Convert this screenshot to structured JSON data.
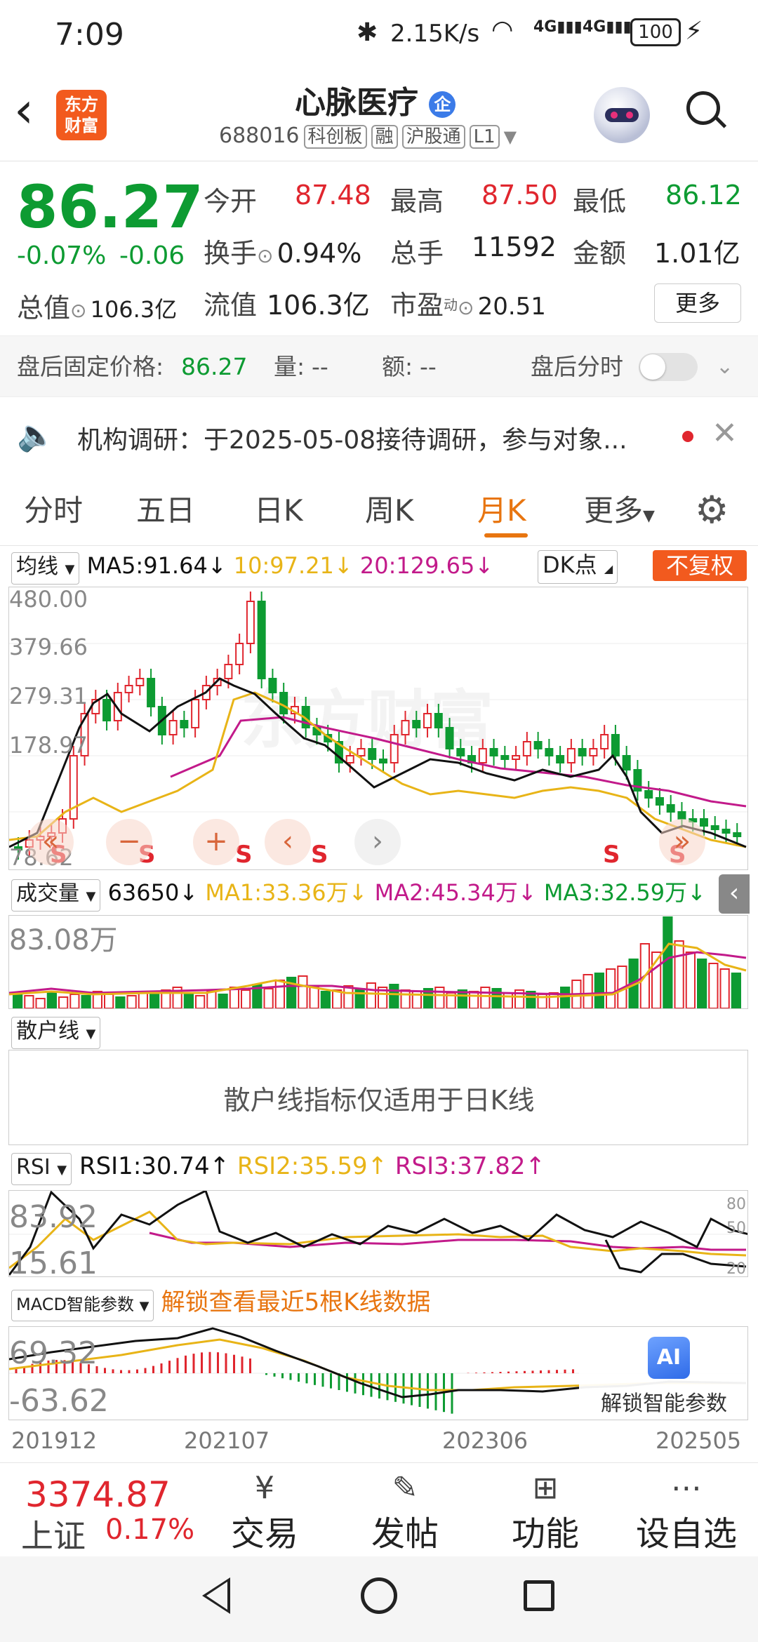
{
  "status_bar": {
    "time": "7:09",
    "net_speed": "2.15K/s",
    "signal1": "4G",
    "signal2": "4G",
    "battery": "100"
  },
  "header": {
    "app_logo_text_top": "东方",
    "app_logo_text_bottom": "财富",
    "stock_name": "心脉医疗",
    "badge": "企",
    "code": "688016",
    "tags": [
      "科创板",
      "融",
      "沪股通",
      "L1"
    ]
  },
  "quote": {
    "price": "86.27",
    "change_pct": "-0.07%",
    "change": "-0.06",
    "open_label": "今开",
    "open": "87.48",
    "high_label": "最高",
    "high": "87.50",
    "low_label": "最低",
    "low": "86.12",
    "turnover_label": "换手",
    "turnover": "0.94%",
    "volume_label": "总手",
    "volume": "11592",
    "amount_label": "金额",
    "amount": "1.01亿",
    "mktcap_label": "总值",
    "mktcap": "106.3亿",
    "float_label": "流值",
    "float": "106.3亿",
    "pe_label": "市盈",
    "pe_sup": "动",
    "pe": "20.51",
    "more_button": "更多"
  },
  "after_hours": {
    "label": "盘后固定价格:",
    "price": "86.27",
    "vol_label": "量:",
    "vol": "--",
    "amt_label": "额:",
    "amt": "--",
    "toggle_label": "盘后分时",
    "toggle_on": false
  },
  "notice": {
    "text": "机构调研：于2025-05-08接待调研，参与对象..."
  },
  "tabs": [
    "分时",
    "五日",
    "日K",
    "周K",
    "月K",
    "更多"
  ],
  "active_tab": 4,
  "ma_bar": {
    "selector": "均线",
    "ma5": "MA5:91.64↓",
    "ma10": "10:97.21↓",
    "ma20": "20:129.65↓",
    "dk_button": "DK点",
    "fq_button": "不复权"
  },
  "kline": {
    "y_labels": [
      "480.00",
      "379.66",
      "279.31",
      "178.97",
      "78.62"
    ],
    "sell_marker": "S"
  },
  "volume_bar": {
    "selector": "成交量",
    "value": "63650↓",
    "ma1": "MA1:33.36万↓",
    "ma2": "MA2:45.34万↓",
    "ma3": "MA3:32.59万↓",
    "y_label": "83.08万"
  },
  "retail_bar": {
    "selector": "散户线",
    "message": "散户线指标仅适用于日K线"
  },
  "rsi_bar": {
    "selector": "RSI",
    "rsi1": "RSI1:30.74↑",
    "rsi2": "RSI2:35.59↑",
    "rsi3": "RSI3:37.82↑",
    "y_labels": [
      "83.92",
      "15.61"
    ],
    "right_labels": [
      "80",
      "50",
      "20"
    ]
  },
  "macd_bar": {
    "selector": "MACD智能参数",
    "unlock_text": "解锁查看最近5根K线数据",
    "y_labels": [
      "69.32",
      "-63.62"
    ],
    "ai_label": "解锁智能参数"
  },
  "x_axis": [
    "201912",
    "202107",
    "202306",
    "202505"
  ],
  "bottom_bar": {
    "index_value": "3374.87",
    "index_name": "上证",
    "index_change": "0.17%",
    "items": [
      "交易",
      "发帖",
      "功能",
      "设自选"
    ]
  },
  "colors": {
    "up": "#e0262e",
    "down": "#0d9b32",
    "accent": "#e87510",
    "ma5": "#111111",
    "ma10": "#e8b417",
    "ma20": "#c21a8a"
  }
}
